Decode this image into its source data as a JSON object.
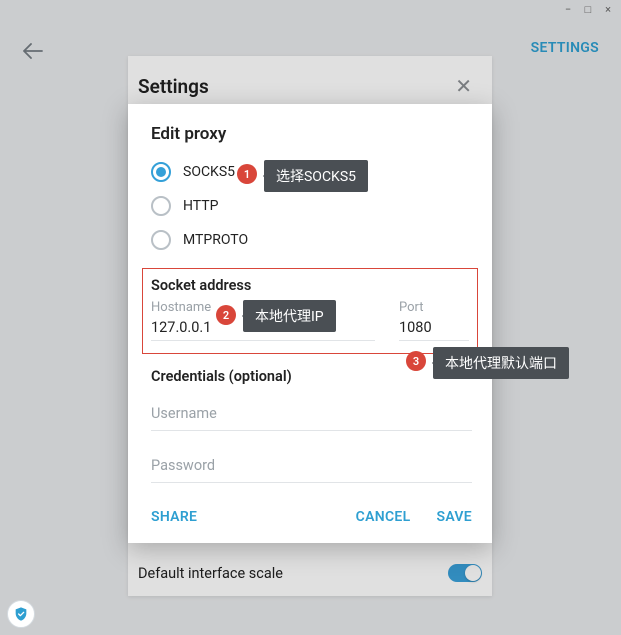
{
  "window_controls": {
    "min": "−",
    "max": "□",
    "close": "×"
  },
  "header": {
    "settings_link": "SETTINGS"
  },
  "settings_panel": {
    "title": "Settings",
    "default_scale_label": "Default interface scale"
  },
  "modal": {
    "title": "Edit proxy",
    "radios": {
      "socks5": "SOCKS5",
      "http": "HTTP",
      "mtproto": "MTPROTO"
    },
    "socket": {
      "title": "Socket address",
      "host_label": "Hostname",
      "host_value": "127.0.0.1",
      "port_label": "Port",
      "port_value": "1080"
    },
    "credentials": {
      "title": "Credentials (optional)",
      "username_placeholder": "Username",
      "password_placeholder": "Password"
    },
    "actions": {
      "share": "SHARE",
      "cancel": "CANCEL",
      "save": "SAVE"
    }
  },
  "annotations": {
    "b1": "1",
    "t1": "选择SOCKS5",
    "b2": "2",
    "t2": "本地代理IP",
    "b3": "3",
    "t3": "本地代理默认端口"
  },
  "colors": {
    "accent": "#2e9fd1",
    "danger": "#d9463a",
    "toggle": "#3aa0d9"
  }
}
